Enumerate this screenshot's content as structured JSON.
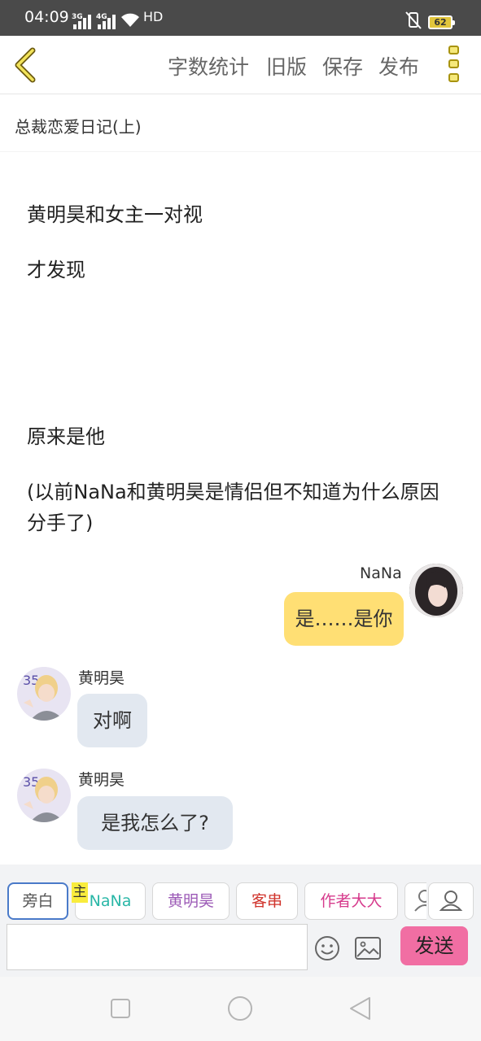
{
  "status_bar": {
    "time": "04:09",
    "network1": "3G",
    "network2": "4G",
    "hd": "HD",
    "battery": "62"
  },
  "nav": {
    "back_icon": "chevron-left-icon",
    "word_count": "字数统计",
    "old_version": "旧版",
    "save": "保存",
    "publish": "发布",
    "menu_icon": "more-vertical-icon"
  },
  "document": {
    "title": "总裁恋爱日记(上)",
    "paragraphs": [
      "黄明昊和女主一对视",
      "才发现",
      "原来是他",
      "(以前NaNa和黄明昊是情侣但不知道为什么原因分手了)"
    ]
  },
  "chat": [
    {
      "speaker": "NaNa",
      "text": "是……是你",
      "side": "right"
    },
    {
      "speaker": "黄明昊",
      "text": "对啊",
      "side": "left"
    },
    {
      "speaker": "黄明昊",
      "text": "是我怎么了?",
      "side": "left"
    }
  ],
  "composer": {
    "chips": [
      "旁白",
      "NaNa",
      "黄明昊",
      "客串",
      "作者大大"
    ],
    "host_badge": "主",
    "send": "发送",
    "emoji_icon": "smiley-icon",
    "image_icon": "image-icon",
    "person_icon": "person-icon"
  },
  "colors": {
    "accent_yellow": "#f5e87a",
    "bubble_mine": "#ffdf74",
    "bubble_other": "#e2e8f0",
    "send": "#f16ea3",
    "chip_nana": "#2ab7a7",
    "chip_hmh": "#9b59b6",
    "chip_guest": "#d0342c",
    "chip_author": "#d63a8c"
  }
}
